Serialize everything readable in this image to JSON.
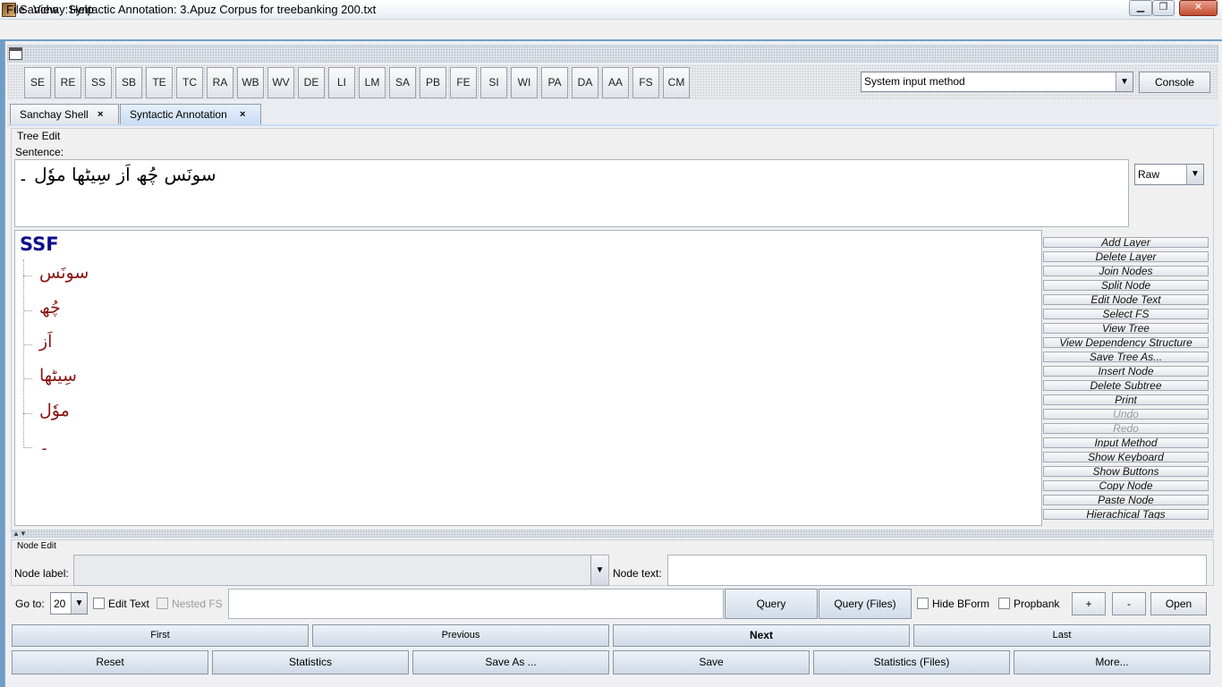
{
  "window": {
    "title": "Sanchay:Syntactic Annotation: 3.Apuz Corpus for treebanking 200.txt",
    "minimize": "▁",
    "maximize": "❐",
    "close": "✕"
  },
  "menu": [
    "File",
    "View",
    "Help"
  ],
  "toolbar": {
    "buttons": [
      "SE",
      "RE",
      "SS",
      "SB",
      "TE",
      "TC",
      "RA",
      "WB",
      "WV",
      "DE",
      "LI",
      "LM",
      "SA",
      "PB",
      "FE",
      "SI",
      "WI",
      "PA",
      "DA",
      "AA",
      "FS",
      "CM"
    ],
    "input_method": "System input method",
    "console": "Console"
  },
  "tabs": [
    {
      "label": "Sanchay Shell",
      "close": "×"
    },
    {
      "label": "Syntactic Annotation",
      "close": "×"
    }
  ],
  "tree_edit": {
    "title": "Tree Edit",
    "sentence_label": "Sentence:",
    "sentence": "سونَس چُھ اَز سِیٹھا موٗل ۔",
    "format": "Raw",
    "root": "SSF",
    "nodes": [
      "سونَس",
      "چُھ",
      "اَز",
      "سِیٹھا",
      "موٗل",
      "۔"
    ]
  },
  "side_buttons": [
    {
      "label": "Add Layer",
      "enabled": true
    },
    {
      "label": "Delete Layer",
      "enabled": true
    },
    {
      "label": "Join Nodes",
      "enabled": true
    },
    {
      "label": "Split Node",
      "enabled": true
    },
    {
      "label": "Edit Node Text",
      "enabled": true
    },
    {
      "label": "Select FS",
      "enabled": true
    },
    {
      "label": "View Tree",
      "enabled": true
    },
    {
      "label": "View Dependency Structure",
      "enabled": true
    },
    {
      "label": "Save Tree As...",
      "enabled": true
    },
    {
      "label": "Insert Node",
      "enabled": true
    },
    {
      "label": "Delete Subtree",
      "enabled": true
    },
    {
      "label": "Print",
      "enabled": true
    },
    {
      "label": "Undo",
      "enabled": false
    },
    {
      "label": "Redo",
      "enabled": false
    },
    {
      "label": "Input Method",
      "enabled": true
    },
    {
      "label": "Show Keyboard",
      "enabled": true
    },
    {
      "label": "Show Buttons",
      "enabled": true
    },
    {
      "label": "Copy Node",
      "enabled": true
    },
    {
      "label": "Paste Node",
      "enabled": true
    },
    {
      "label": "Hierachical Tags",
      "enabled": true
    }
  ],
  "node_edit": {
    "title": "Node Edit",
    "node_label": "Node label:",
    "node_text": "Node text:"
  },
  "goto": {
    "label": "Go to:",
    "value": "20",
    "edit_text": "Edit Text",
    "nested_fs": "Nested FS",
    "query": "Query",
    "query_files": "Query (Files)",
    "hide_bform": "Hide BForm",
    "propbank": "Propbank",
    "plus": "+",
    "minus": "-",
    "open": "Open"
  },
  "nav": [
    "First",
    "Previous",
    "Next",
    "Last"
  ],
  "actions": [
    "Reset",
    "Statistics",
    "Save As ...",
    "Save",
    "Statistics (Files)",
    "More..."
  ],
  "icons": {
    "app": "app-icon",
    "strip": "window-icon",
    "split": "split-arrows-icon"
  },
  "colors": {
    "root": "#0d0d8c",
    "node": "#8b1212"
  }
}
